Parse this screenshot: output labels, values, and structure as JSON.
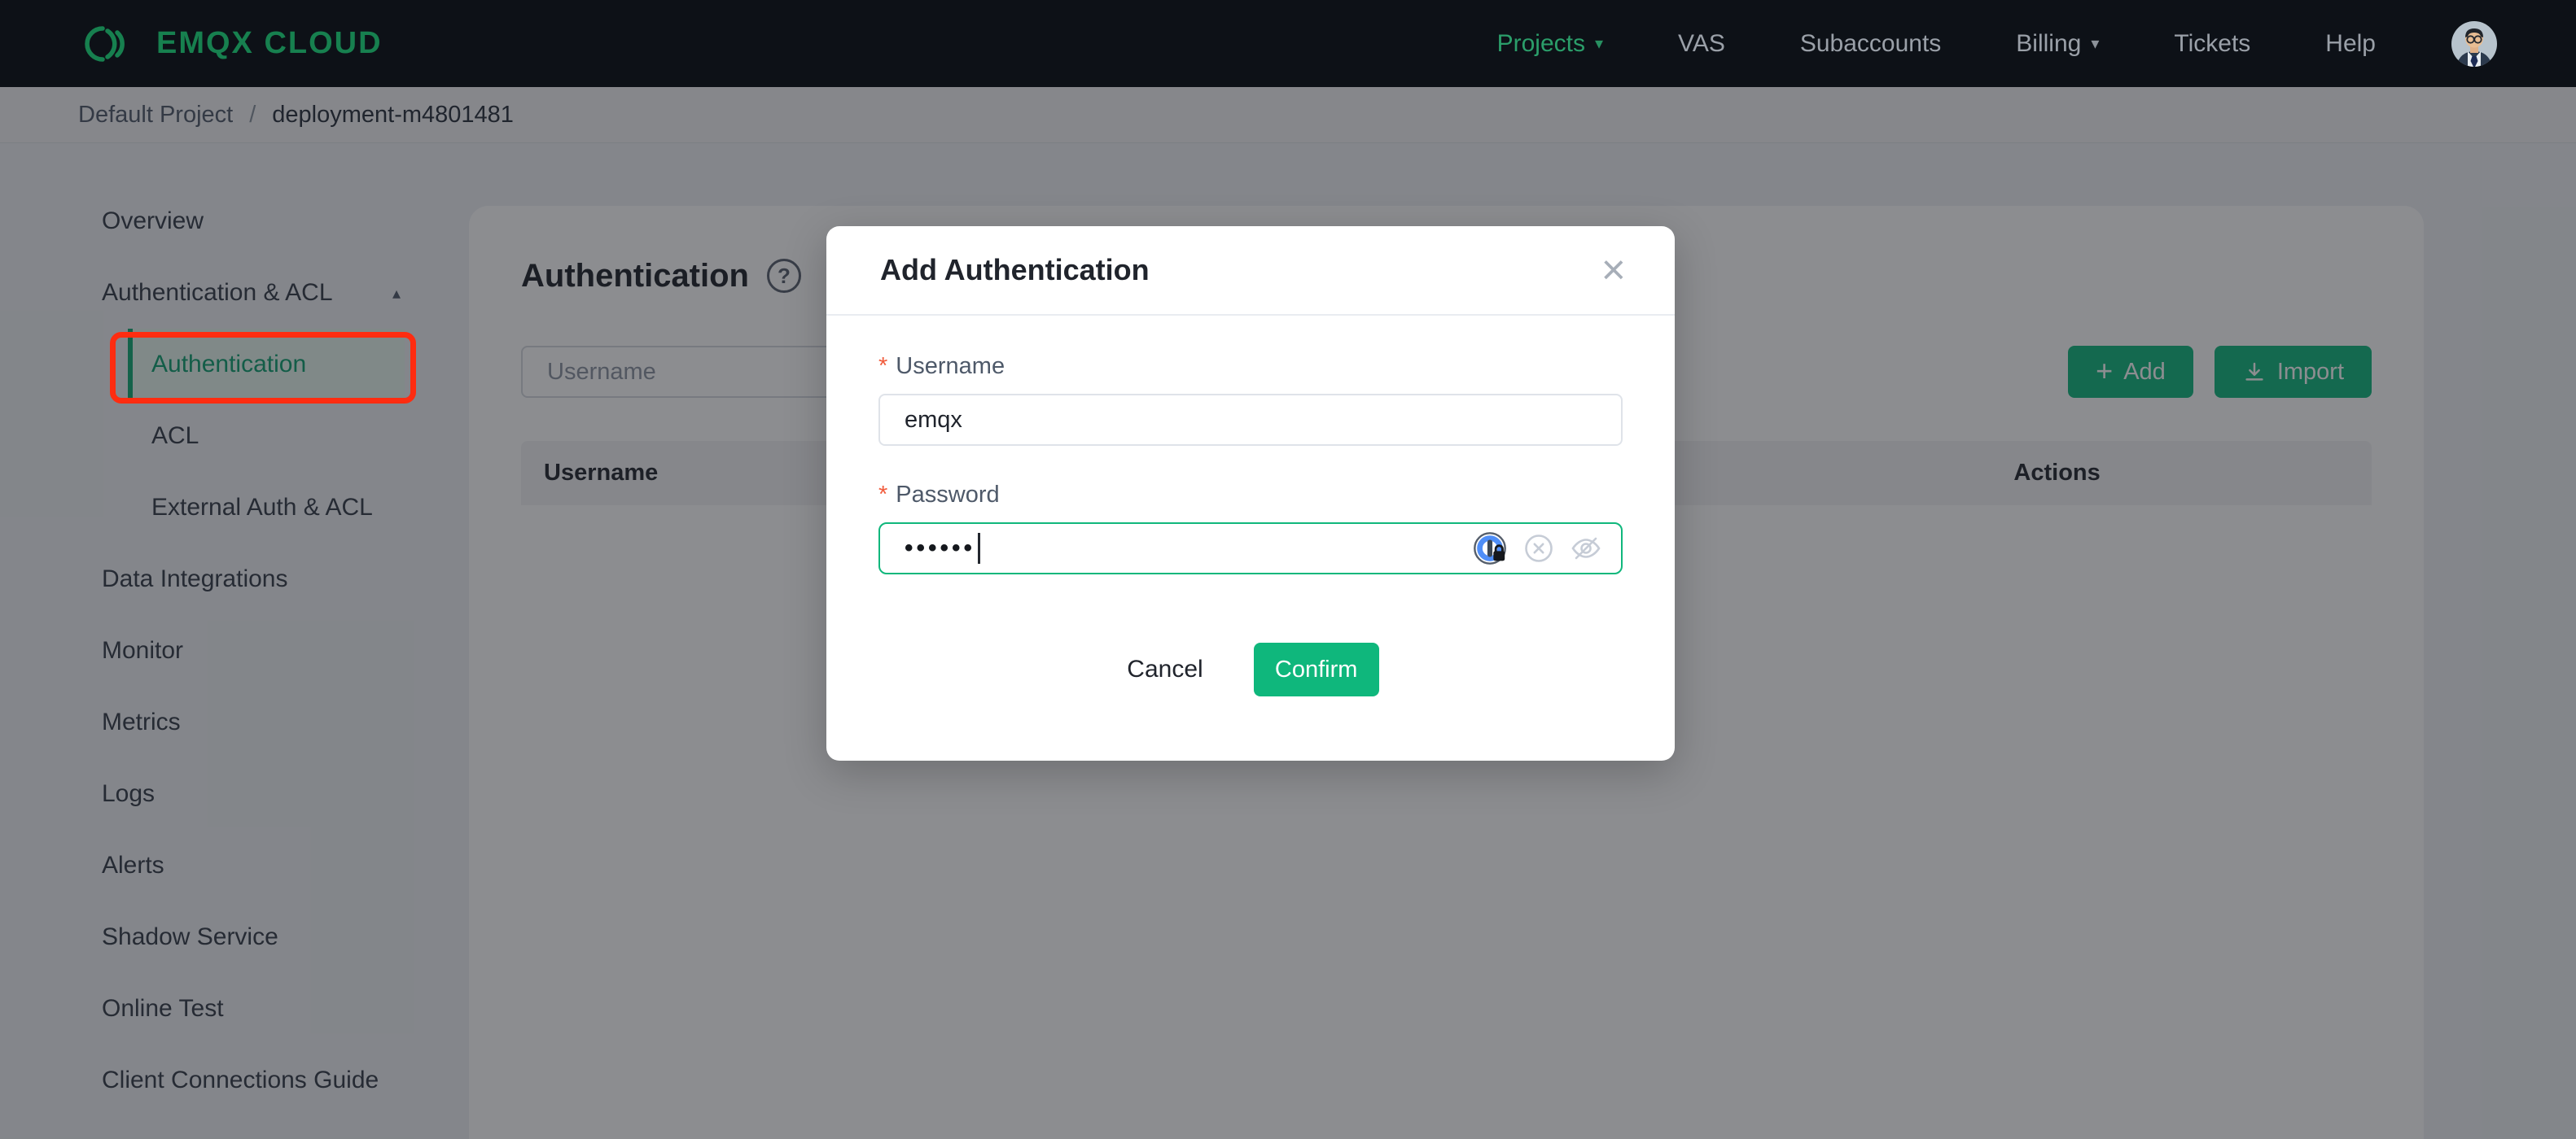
{
  "colors": {
    "brand_green": "#0fb77c",
    "topbar_bg": "#0d1117",
    "logo_green": "#17804f",
    "nav_active_green": "#2b9e6a",
    "annotation_red": "#fe2c10",
    "required_mark": "#f15c3d",
    "selected_item_green": "#0c9e6e"
  },
  "topnav": {
    "logo_text": "EMQX CLOUD",
    "items": [
      {
        "label": "Projects",
        "caret": "▾",
        "active": true
      },
      {
        "label": "VAS"
      },
      {
        "label": "Subaccounts"
      },
      {
        "label": "Billing",
        "caret": "▾"
      },
      {
        "label": "Tickets"
      },
      {
        "label": "Help"
      }
    ]
  },
  "breadcrumb": {
    "project": "Default Project",
    "separator": "/",
    "deployment": "deployment-m4801481"
  },
  "sidebar": {
    "items": [
      {
        "label": "Overview"
      },
      {
        "label": "Authentication & ACL",
        "caret": "▴",
        "expanded": true
      },
      {
        "label": "Authentication",
        "child": true,
        "selected": true
      },
      {
        "label": "ACL",
        "child": true
      },
      {
        "label": "External Auth & ACL",
        "child": true
      },
      {
        "label": "Data Integrations"
      },
      {
        "label": "Monitor"
      },
      {
        "label": "Metrics"
      },
      {
        "label": "Logs"
      },
      {
        "label": "Alerts"
      },
      {
        "label": "Shadow Service"
      },
      {
        "label": "Online Test"
      },
      {
        "label": "Client Connections Guide"
      }
    ]
  },
  "main": {
    "title": "Authentication",
    "help_icon": "?",
    "search_placeholder": "Username",
    "add_button": {
      "label": "Add",
      "icon": "plus-icon",
      "icon_glyph": "+"
    },
    "import_button": {
      "label": "Import",
      "icon": "download-icon"
    },
    "table": {
      "headers": [
        "Username",
        "Actions"
      ]
    }
  },
  "modal": {
    "title": "Add Authentication",
    "close_icon": "×",
    "username_field": {
      "required_mark": "*",
      "label": "Username",
      "value": "emqx"
    },
    "password_field": {
      "required_mark": "*",
      "label": "Password",
      "masked_value": "••••••"
    },
    "cancel_label": "Cancel",
    "confirm_label": "Confirm"
  }
}
